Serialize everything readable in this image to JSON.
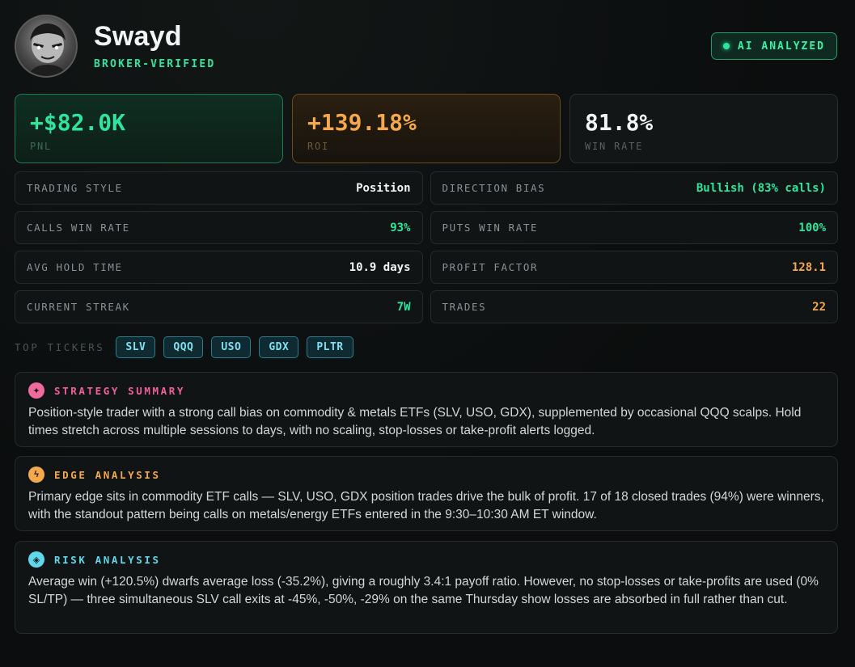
{
  "profile": {
    "name": "Swayd",
    "verified_label": "BROKER-VERIFIED",
    "ai_badge": "AI ANALYZED"
  },
  "stats": [
    {
      "value": "+$82.0K",
      "label": "PNL"
    },
    {
      "value": "+139.18%",
      "label": "ROI"
    },
    {
      "value": "81.8%",
      "label": "WIN RATE"
    }
  ],
  "metrics": [
    {
      "label": "TRADING STYLE",
      "value": "Position"
    },
    {
      "label": "DIRECTION BIAS",
      "value": "Bullish (83% calls)"
    },
    {
      "label": "CALLS WIN RATE",
      "value": "93%"
    },
    {
      "label": "PUTS WIN RATE",
      "value": "100%"
    },
    {
      "label": "AVG HOLD TIME",
      "value": "10.9 days"
    },
    {
      "label": "PROFIT FACTOR",
      "value": "128.1"
    },
    {
      "label": "CURRENT STREAK",
      "value": "7W"
    },
    {
      "label": "TRADES",
      "value": "22"
    }
  ],
  "tickers": {
    "label": "TOP TICKERS",
    "items": [
      "SLV",
      "QQQ",
      "USO",
      "GDX",
      "PLTR"
    ]
  },
  "analysis": [
    {
      "title": "STRATEGY SUMMARY",
      "icon": "sparkle-icon",
      "body": "Position-style trader with a strong call bias on commodity & metals ETFs (SLV, USO, GDX), supplemented by occasional QQQ scalps. Hold times stretch across multiple sessions to days, with no scaling, stop-losses or take-profit alerts logged."
    },
    {
      "title": "EDGE ANALYSIS",
      "icon": "lightning-icon",
      "body": "Primary edge sits in commodity ETF calls — SLV, USO, GDX position trades drive the bulk of profit. 17 of 18 closed trades (94%) were winners, with the standout pattern being calls on metals/energy ETFs entered in the 9:30–10:30 AM ET window."
    },
    {
      "title": "RISK ANALYSIS",
      "icon": "diamond-icon",
      "body": "Average win (+120.5%) dwarfs average loss (-35.2%), giving a roughly 3.4:1 payoff ratio. However, no stop-losses or take-profits are used (0% SL/TP) — three simultaneous SLV call exits at -45%, -50%, -29% on the same Thursday show losses are absorbed in full rather than cut."
    }
  ],
  "colors": {
    "green": "#2ee59d",
    "orange": "#f5a94a",
    "cyan": "#5fd8ec",
    "pink": "#f0609a"
  }
}
